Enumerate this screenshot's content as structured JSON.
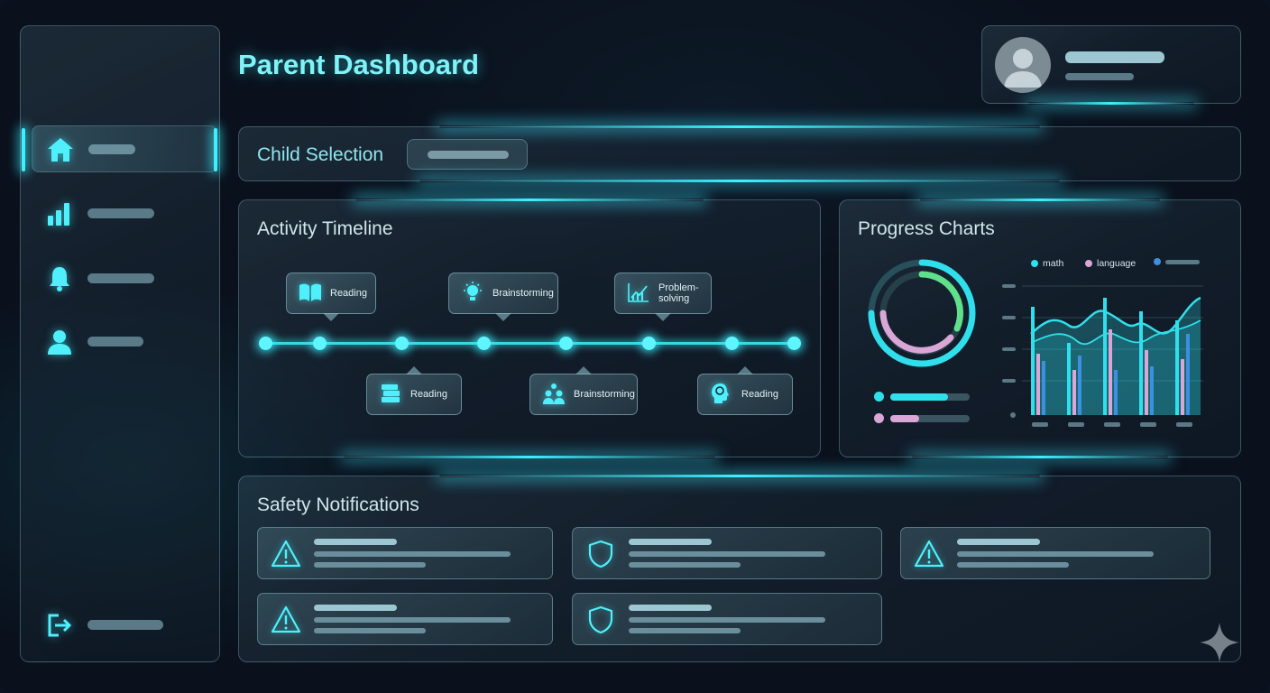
{
  "page": {
    "title": "Parent Dashboard"
  },
  "sidebar": {
    "items": [
      {
        "icon": "home-icon",
        "active": true
      },
      {
        "icon": "bar-chart-icon",
        "active": false
      },
      {
        "icon": "bell-icon",
        "active": false
      },
      {
        "icon": "user-icon",
        "active": false
      }
    ],
    "logout": {
      "icon": "logout-icon"
    }
  },
  "profile": {
    "icon": "avatar-icon"
  },
  "child_selection": {
    "label": "Child Selection"
  },
  "timeline": {
    "title": "Activity Timeline",
    "events_top": [
      {
        "label": "Reading",
        "icon": "book-icon"
      },
      {
        "label": "Brainstorming",
        "icon": "lightbulb-icon"
      },
      {
        "label": "Problem-\nsolving",
        "icon": "chart-icon"
      }
    ],
    "events_bottom": [
      {
        "label": "Reading",
        "icon": "books-stack-icon"
      },
      {
        "label": "Brainstorming",
        "icon": "group-idea-icon"
      },
      {
        "label": "Reading",
        "icon": "brain-head-icon"
      }
    ]
  },
  "progress": {
    "title": "Progress Charts",
    "legend": [
      {
        "label": "math",
        "color": "#2fe0ec"
      },
      {
        "label": "language",
        "color": "#d9a6d6"
      },
      {
        "label": "",
        "color": "#3d8fe0"
      }
    ]
  },
  "safety": {
    "title": "Safety Notifications",
    "cards": [
      {
        "icon": "warning-icon"
      },
      {
        "icon": "shield-icon"
      },
      {
        "icon": "warning-icon"
      },
      {
        "icon": "warning-icon"
      },
      {
        "icon": "shield-icon"
      }
    ]
  },
  "colors": {
    "accent": "#3ef0ff",
    "title": "#7ff3f8",
    "background": "#0a111d"
  }
}
